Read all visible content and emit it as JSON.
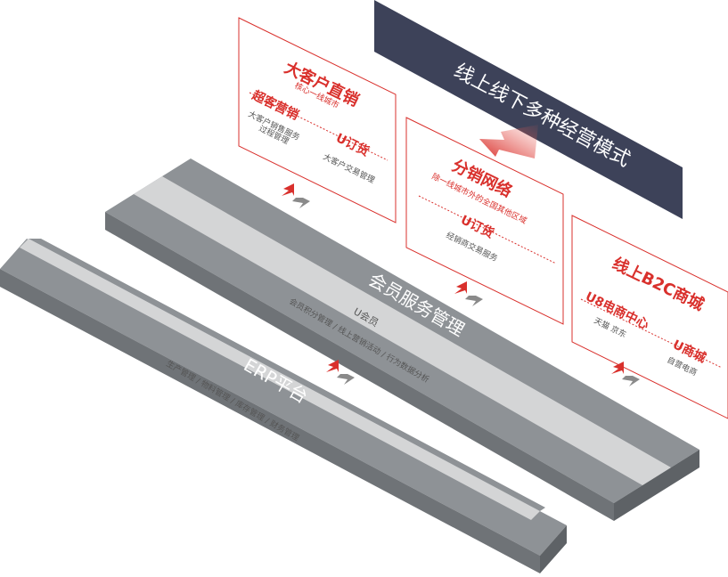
{
  "banner": {
    "title": "线上线下多种经营模式"
  },
  "panels": {
    "enterprise": {
      "title": "大客户直销",
      "subtitle": "核心一线城市",
      "left_title": "超客营销",
      "left_desc1": "大客户销售服务",
      "left_desc2": "过程管理",
      "right_title": "U订货",
      "right_desc": "大客户交易管理"
    },
    "distribution": {
      "title": "分销网络",
      "subtitle": "除一线城市外的全国其他区域",
      "item_title": "U订货",
      "item_desc": "经销商交易服务"
    },
    "b2c": {
      "title": "线上B2C商城",
      "left_title": "U8电商中心",
      "left_desc": "天猫 京东",
      "right_title": "U商城",
      "right_desc": "自营电商"
    }
  },
  "platforms": {
    "member": {
      "title": "会员服务管理",
      "subtitle": "U会员",
      "desc": "会员积分管理 / 线上营销活动 / 行为数据分析"
    },
    "erp": {
      "title": "ERP平台",
      "desc": "生产管理 / 物料管理 / 库存管理 / 财务管理"
    }
  },
  "colors": {
    "accent_red": "#d9302c",
    "banner_navy": "#3d4259",
    "platform_gray": "#8e9296",
    "platform_light": "#d4d5d6"
  },
  "icons": [
    "exchange-arrows-icon",
    "red-arrow-icon"
  ]
}
